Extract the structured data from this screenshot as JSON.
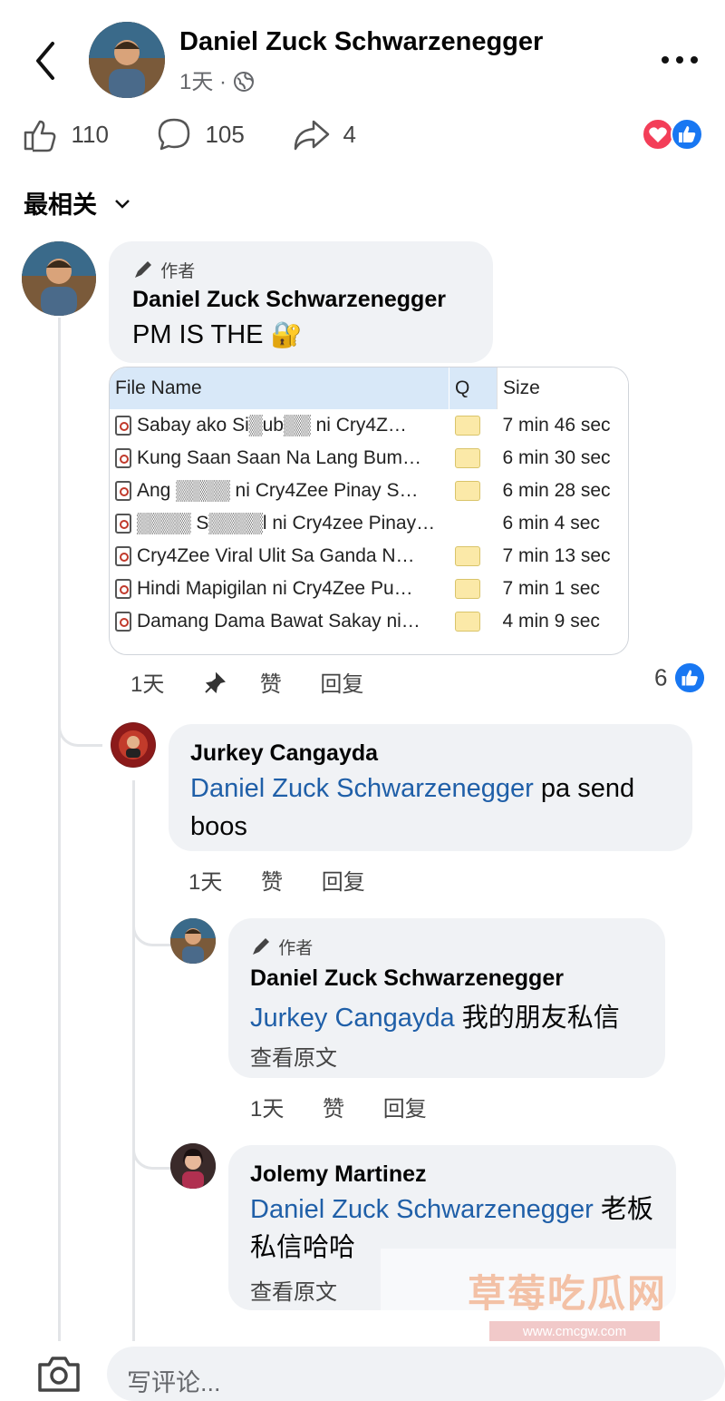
{
  "header": {
    "back_icon": "chevron-left-icon",
    "author": "Daniel Zuck Schwarzenegger",
    "time": "1天",
    "dot": "·",
    "privacy_icon": "globe-icon",
    "more_icon": "more-dots-icon"
  },
  "stats": {
    "likes": "110",
    "comments": "105",
    "shares": "4"
  },
  "sort": {
    "label": "最相关"
  },
  "comments": [
    {
      "badge": "作者",
      "name": "Daniel Zuck Schwarzenegger",
      "text": "PM IS THE",
      "emoji": "🔐",
      "time": "1天",
      "like": "赞",
      "reply": "回复",
      "reactions": "6"
    },
    {
      "name": "Jurkey Cangayda",
      "mention": "Daniel Zuck Schwarzenegger",
      "text": "pa send boos",
      "time": "1天",
      "like": "赞",
      "reply": "回复"
    },
    {
      "badge": "作者",
      "name": "Daniel Zuck Schwarzenegger",
      "mention": "Jurkey Cangayda",
      "text": "我的朋友私信",
      "see_original": "查看原文",
      "time": "1天",
      "like": "赞",
      "reply": "回复"
    },
    {
      "name": "Jolemy Martinez",
      "mention": "Daniel Zuck Schwarzenegger",
      "text": "老板私信哈哈",
      "see_original": "查看原文"
    }
  ],
  "file_table": {
    "headers": [
      "File Name",
      "Q",
      "Size"
    ],
    "rows": [
      {
        "name": "Sabay ako Si▒ub▒▒ ni Cry4Z…",
        "size": "7 min 46 sec"
      },
      {
        "name": "Kung Saan Saan Na Lang Bum…",
        "size": "6 min 30 sec"
      },
      {
        "name": "Ang ▒▒▒▒ ni Cry4Zee Pinay S…",
        "size": "6 min 28 sec"
      },
      {
        "name": "▒▒▒▒ S▒▒▒▒l ni Cry4zee Pinay…",
        "size": "6 min 4 sec"
      },
      {
        "name": "Cry4Zee Viral Ulit Sa Ganda N…",
        "size": "7 min 13 sec"
      },
      {
        "name": "Hindi Mapigilan ni Cry4Zee Pu…",
        "size": "7 min 1 sec"
      },
      {
        "name": "Damang Dama Bawat Sakay ni…",
        "size": "4 min 9 sec"
      }
    ]
  },
  "composer": {
    "placeholder": "写评论...",
    "camera_icon": "camera-icon"
  },
  "watermark": {
    "text": "草莓吃瓜网",
    "url": "www.cmcgw.com"
  },
  "colors": {
    "link": "#1f5fa8",
    "like_blue": "#1877f2",
    "love_red": "#f33e58",
    "bubble": "#f0f2f5"
  }
}
